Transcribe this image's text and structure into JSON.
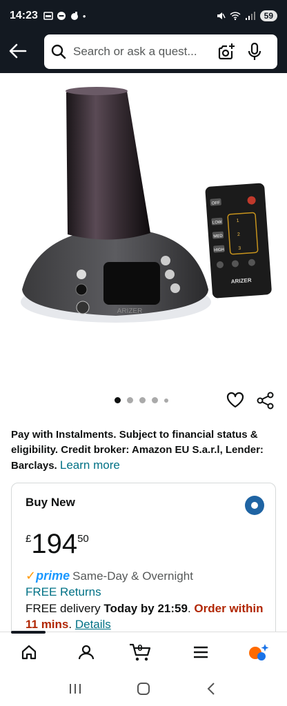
{
  "status_bar": {
    "time": "14:23",
    "battery": "59"
  },
  "search": {
    "placeholder": "Search or ask a quest..."
  },
  "gallery": {
    "total_images": 5,
    "active_index": 0,
    "device_brand_label": "ARIZER",
    "remote_buttons": [
      "OFF",
      "LOW",
      "MED",
      "HIGH",
      "1",
      "2",
      "3"
    ]
  },
  "instalments": {
    "text": "Pay with Instalments. Subject to financial status & eligibility. Credit broker: Amazon EU S.a.r.l, Lender: Barclays.",
    "link": "Learn more"
  },
  "buy_box": {
    "title": "Buy New",
    "price_symbol": "£",
    "price_whole": "194",
    "price_fraction": "50",
    "prime_label": "prime",
    "prime_text": "Same-Day & Overnight",
    "returns": "FREE Returns",
    "delivery_prefix": "FREE delivery",
    "delivery_date": "Today by 21:59",
    "delivery_period": ".",
    "order_text": "Order within 11 mins",
    "details_link": "Details"
  },
  "bottom_nav": {
    "cart_count": "0"
  },
  "colors": {
    "header_bg": "#131921",
    "link": "#007185",
    "urgent": "#b12704",
    "prime": "#1a98ff",
    "radio": "#1f64a3"
  }
}
